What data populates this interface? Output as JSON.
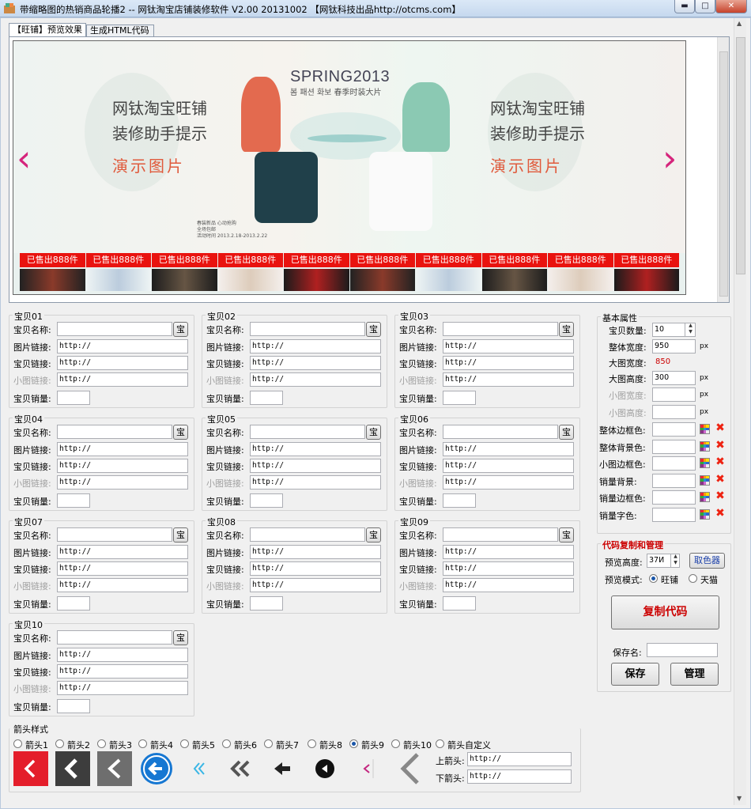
{
  "window": {
    "title": "带缩略图的热销商品轮播2 -- 网钛淘宝店铺装修软件 V2.00 20131002 【网钛科技出品http://otcms.com】",
    "min_label": "▬",
    "max_label": "□",
    "close_label": "✕"
  },
  "tabs": [
    {
      "label": "【旺铺】预览效果",
      "active": true
    },
    {
      "label": "生成HTML代码",
      "active": false
    }
  ],
  "banner": {
    "title": "SPRING2013",
    "subtitle": "봄 패션 화보 春季时装大片",
    "promo_left": {
      "line1": "网钛淘宝旺铺",
      "line2": "装修助手提示",
      "line3": "演示图片"
    },
    "promo_right": {
      "line1": "网钛淘宝旺铺",
      "line2": "装修助手提示",
      "line3": "演示图片"
    },
    "small_note": [
      "春装新品 心动抢购",
      "全场包邮",
      "活动时间 2013.2.18-2013.2.22"
    ],
    "arrow_left": "‹",
    "arrow_right": "›",
    "sold_label": "已售出888件"
  },
  "items": [
    {
      "title": "宝贝01"
    },
    {
      "title": "宝贝02"
    },
    {
      "title": "宝贝03"
    },
    {
      "title": "宝贝04"
    },
    {
      "title": "宝贝05"
    },
    {
      "title": "宝贝06"
    },
    {
      "title": "宝贝07"
    },
    {
      "title": "宝贝08"
    },
    {
      "title": "宝贝09"
    },
    {
      "title": "宝贝10"
    }
  ],
  "item_fields": {
    "name_label": "宝贝名称:",
    "img_link_label": "图片链接:",
    "item_link_label": "宝贝链接:",
    "thumb_link_label": "小图链接:",
    "sales_label": "宝贝销量:",
    "link_value": "http://",
    "bao_button": "宝"
  },
  "basic": {
    "title": "基本属性",
    "count_label": "宝贝数量:",
    "count_value": "10",
    "width_label": "整体宽度:",
    "width_value": "950",
    "bigwidth_label": "大图宽度:",
    "bigwidth_value": "850",
    "bigheight_label": "大图高度:",
    "bigheight_value": "300",
    "thumbwidth_label": "小图宽度:",
    "thumbheight_label": "小图高度:",
    "px": "px",
    "colors": [
      "整体边框色:",
      "整体背景色:",
      "小图边框色:",
      "销量背景:",
      "销量边框色:",
      "销量字色:"
    ]
  },
  "code": {
    "title": "代码复制和管理",
    "preview_height_label": "预览高度:",
    "preview_height_value": "37Ͷ",
    "picker_button": "取色器",
    "mode_label": "预览模式:",
    "mode_wangpu": "旺铺",
    "mode_tianmao": "天猫",
    "copy_button": "复制代码",
    "save_name_label": "保存名:",
    "save_button": "保存",
    "manage_button": "管理"
  },
  "arrows": {
    "title": "箭头样式",
    "options": [
      "箭头1",
      "箭头2",
      "箭头3",
      "箭头4",
      "箭头5",
      "箭头6",
      "箭头7",
      "箭头8",
      "箭头9",
      "箭头10",
      "箭头自定义"
    ],
    "selected_index": 8,
    "upper_label": "上箭头:",
    "lower_label": "下箭头:",
    "upper_value": "http://",
    "lower_value": "http://"
  }
}
